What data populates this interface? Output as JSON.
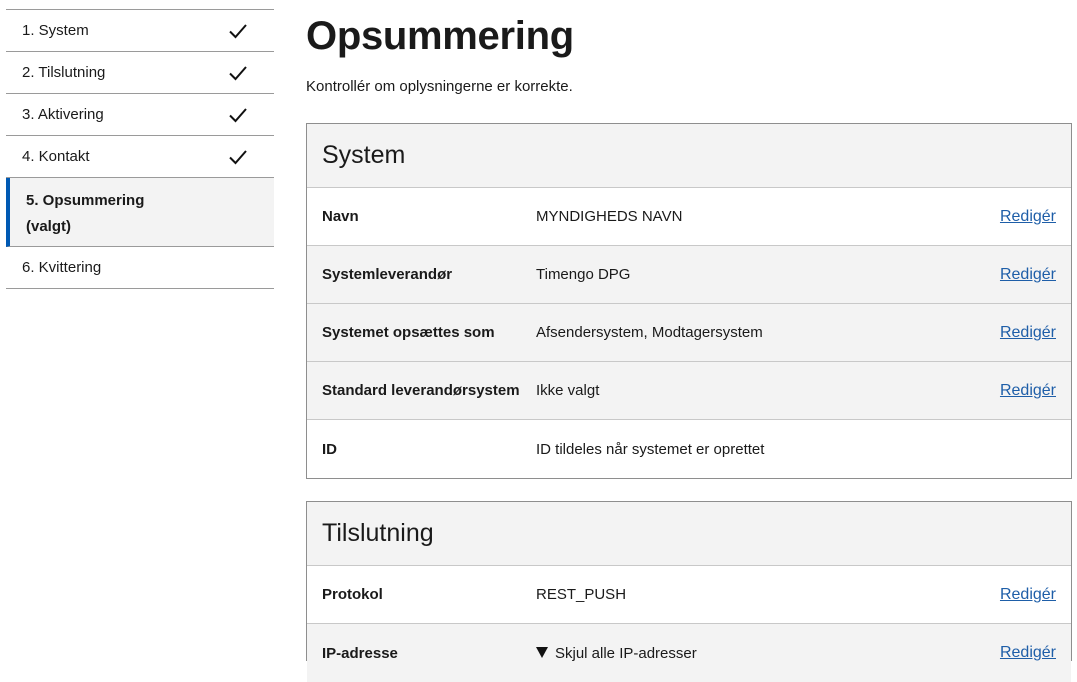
{
  "steps": [
    {
      "label": "1. System",
      "done": true
    },
    {
      "label": "2. Tilslutning",
      "done": true
    },
    {
      "label": "3. Aktivering",
      "done": true
    },
    {
      "label": "4. Kontakt",
      "done": true
    },
    {
      "label": "5. Opsummering (valgt)",
      "done": false,
      "active": true
    },
    {
      "label": "6. Kvittering",
      "done": false
    }
  ],
  "page": {
    "title": "Opsummering",
    "intro": "Kontrollér om oplysningerne er korrekte."
  },
  "system": {
    "heading": "System",
    "rows": [
      {
        "key": "Navn",
        "value": "MYNDIGHEDS NAVN",
        "edit": "Redigér"
      },
      {
        "key": "Systemleverandør",
        "value": "Timengo DPG",
        "edit": "Redigér"
      },
      {
        "key": "Systemet opsættes som",
        "value": "Afsendersystem, Modtagersystem",
        "edit": "Redigér"
      },
      {
        "key": "Standard leverandørsystem",
        "value": "Ikke valgt",
        "edit": "Redigér"
      },
      {
        "key": "ID",
        "value": "ID tildeles når systemet er oprettet"
      }
    ]
  },
  "connection": {
    "heading": "Tilslutning",
    "rows": [
      {
        "key": "Protokol",
        "value": "REST_PUSH",
        "edit": "Redigér"
      },
      {
        "key": "IP-adresse",
        "value": "Skjul alle IP-adresser",
        "edit": "Redigér"
      }
    ]
  },
  "colors": {
    "accent": "#0059b3",
    "link": "#1e5ea8",
    "shade": "#f3f3f3"
  }
}
